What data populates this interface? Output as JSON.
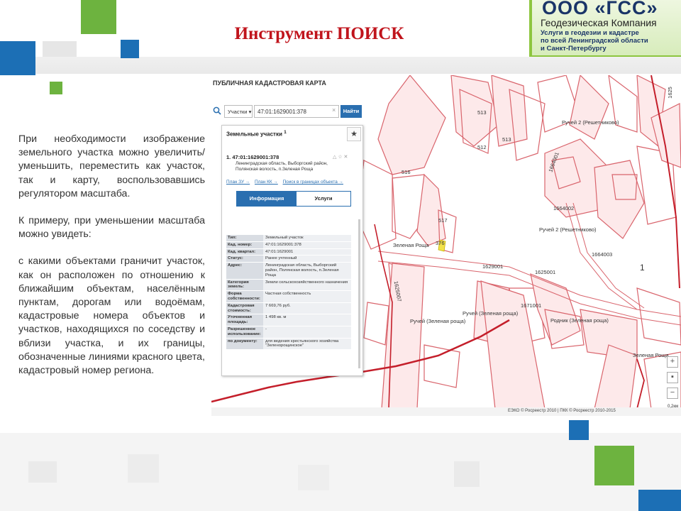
{
  "slide": {
    "title": "Инструмент ПОИСК",
    "colors": {
      "title": "#c0141c",
      "blue_square": "#1c6fb5",
      "green_square": "#6db33f",
      "map_line": "#c41e2a"
    }
  },
  "logo": {
    "name": "ООО «ГСС»",
    "subtitle": "Геодезическая Компания",
    "desc_lines": [
      "Услуги в геодезии и кадастре",
      "по всей Ленинградской области",
      "и Санкт-Петербургу"
    ]
  },
  "text": {
    "p1": "При необходимости изображение земельного участка можно увеличить/уменьшить, переместить как участок, так и карту, воспользовавшись регулятором масштаба.",
    "p2": "К примеру, при уменьшении масштаба можно увидеть:",
    "p3": "с какими объектами граничит участок, как он расположен по отношению к ближайшим объектам, населённым пунктам, дорогам или водоёмам, кадастровые номера объектов и участков, находящихся по соседству и вблизи участка, и их границы, обозначенные линиями красного цвета, кадастровый номер региона."
  },
  "app": {
    "header": "ПУБЛИЧНАЯ КАДАСТРОВАЯ КАРТА",
    "search_type": "Участки ▾",
    "search_value": "47:01:1629001:378",
    "search_clear": "×",
    "search_button": "Найти",
    "panel_title": "Земельные участки",
    "panel_count": "1",
    "result": {
      "index": "1.",
      "number": "47:01:1629001:378",
      "address": "Ленинградская область, Выборгский район, Полянская волость, п.Зеленая Роща",
      "tools": "△ ☆ ✕",
      "links": [
        "План ЗУ →",
        "План КК →",
        "Поиск в границах объекта →"
      ]
    },
    "tabs": {
      "info": "Информация",
      "services": "Услуги"
    },
    "rows": [
      {
        "k": "Тип:",
        "v": "Земельный участок"
      },
      {
        "k": "Кад. номер:",
        "v": "47:01:1629001:378"
      },
      {
        "k": "Кад. квартал:",
        "v": "47:01:1629001"
      },
      {
        "k": "Статус:",
        "v": "Ранее учтенный"
      },
      {
        "k": "Адрес:",
        "v": "Ленинградская область, Выборгский район, Полянская волость, п.Зеленая Роща"
      },
      {
        "k": "Категория земель:",
        "v": "Земли сельскохозяйственного назначения"
      },
      {
        "k": "Форма собственности:",
        "v": "Частная собственность"
      },
      {
        "k": "Кадастровая стоимость:",
        "v": "7 669,76 руб."
      },
      {
        "k": "Уточненная площадь:",
        "v": "1 498 кв. м"
      },
      {
        "k": "Разрешенное использование:",
        "v": "-"
      },
      {
        "k": "по документу:",
        "v": "для ведения крестьянского хозяйства \"Зеленорощинское\""
      }
    ]
  },
  "map": {
    "labels": {
      "l513a": "513",
      "l512": "512",
      "l513b": "513",
      "l516": "516",
      "l517": "517",
      "l377": "377",
      "l376": "376",
      "ruchey2_top": "Ручей 2 (Решетниково)",
      "q1664001": "1664001",
      "q1664002": "1664002",
      "ruchey2_mid": "Ручей 2 (Решетниково)",
      "q1664003": "1664003",
      "zel_rosha_a": "Зеленая Роща",
      "q1629001": "1629001",
      "q1625001": "1625001",
      "q1625007": "1625007",
      "q1671001": "1671001",
      "ruchey_zel_a": "Ручей (Зеленая роща)",
      "ruchey_zel_b": "Ручей (Зеленая роща)",
      "rodnik": "Родник (Зеленая роща)",
      "zel_rosha_b": "Зеленая Роща",
      "q1625": "1625",
      "one": "1"
    },
    "region_left": "47",
    "region_right": "47",
    "scale": "0,2км",
    "copyright": "ЕЭКО © Росреестр 2010 | ПКК © Росреестр 2010-2015",
    "zoom_in": "+",
    "zoom_out": "−",
    "zoom_mid": "▪"
  }
}
